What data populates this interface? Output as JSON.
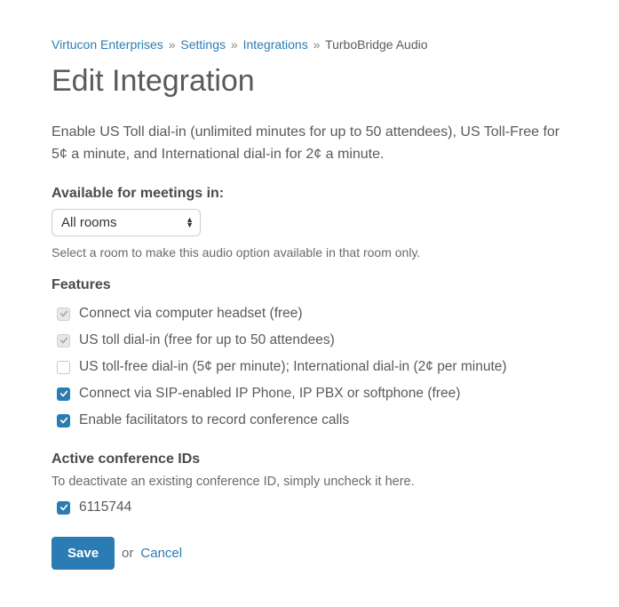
{
  "breadcrumb": {
    "org": "Virtucon Enterprises",
    "settings": "Settings",
    "integrations": "Integrations",
    "current": "TurboBridge Audio",
    "sep": "»"
  },
  "page_title": "Edit Integration",
  "description": "Enable US Toll dial-in (unlimited minutes for up to 50 attendees), US Toll-Free for 5¢ a minute, and International dial-in for 2¢ a minute.",
  "available": {
    "label": "Available for meetings in:",
    "selected": "All rooms",
    "hint": "Select a room to make this audio option available in that room only."
  },
  "features": {
    "label": "Features",
    "items": [
      {
        "label": "Connect via computer headset (free)",
        "state": "disabled-checked"
      },
      {
        "label": "US toll dial-in (free for up to 50 attendees)",
        "state": "disabled-checked"
      },
      {
        "label": "US toll-free dial-in (5¢ per minute); International dial-in (2¢ per minute)",
        "state": "unchecked"
      },
      {
        "label": "Connect via SIP-enabled IP Phone, IP PBX or softphone (free)",
        "state": "checked"
      },
      {
        "label": "Enable facilitators to record conference calls",
        "state": "checked"
      }
    ]
  },
  "conference": {
    "label": "Active conference IDs",
    "subtext": "To deactivate an existing conference ID, simply uncheck it here.",
    "items": [
      {
        "id": "6115744",
        "state": "checked"
      }
    ]
  },
  "actions": {
    "save": "Save",
    "or": "or",
    "cancel": "Cancel"
  }
}
